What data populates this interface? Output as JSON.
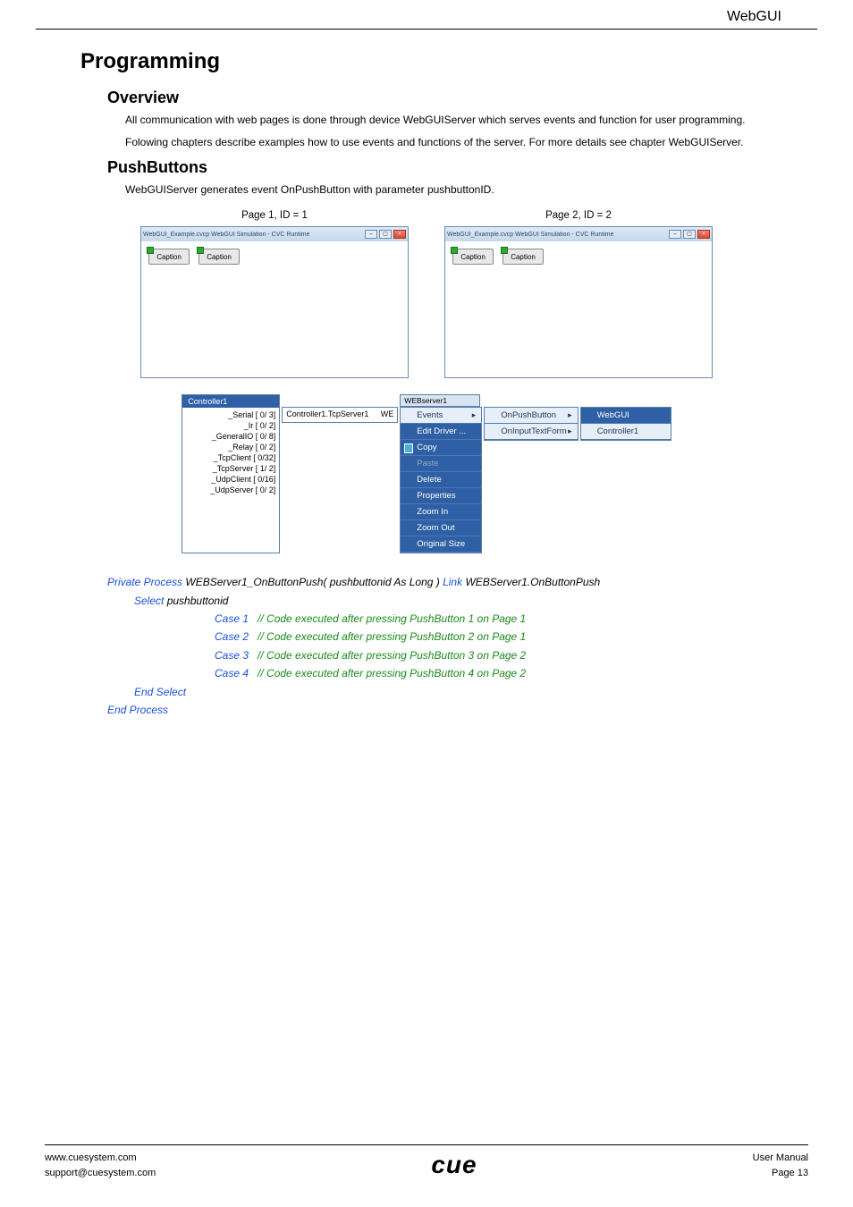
{
  "header": {
    "title": "WebGUI"
  },
  "h1": "Programming",
  "overview": {
    "title": "Overview",
    "p1": "All communication with web pages is done through device WebGUIServer which serves events and function for user programming.",
    "p2": "Folowing chapters describe examples how to use events and functions of the server. For more details see chapter WebGUIServer."
  },
  "push": {
    "title": "PushButtons",
    "p1": "WebGUIServer generates event OnPushButton with parameter pushbuttonID.",
    "page1_label": "Page 1, ID = 1",
    "page2_label": "Page 2, ID = 2",
    "window_title": "WebGUI_Example.cvcp WebGUI Simulation - CVC Runtime",
    "caption": "Caption"
  },
  "diagram": {
    "controller_title": "Controller1",
    "tree": [
      "_Serial [ 0/ 3]",
      "_Ir [ 0/ 2]",
      "_GeneralIO [ 0/ 8]",
      "_Relay [ 0/ 2]",
      "_TcpClient [ 0/32]",
      "_TcpServer [ 1/ 2]",
      "_UdpClient [ 0/16]",
      "_UdpServer [ 0/ 2]"
    ],
    "tcp_label": "Controller1.TcpServer1",
    "tcp_sub": "WE",
    "wb_title": "WEBserver1",
    "ctx": {
      "events": "Events",
      "edit": "Edit Driver ...",
      "copy": "Copy",
      "paste": "Paste",
      "delete": "Delete",
      "props": "Properties",
      "zoomin": "Zoom In",
      "zoomout": "Zoom Out",
      "orig": "Original Size"
    },
    "events_sub": {
      "onpush": "OnPushButton",
      "oninput": "OnInputTextForm"
    },
    "target_sub": {
      "webgui": "WebGUI",
      "ctrl": "Controller1"
    }
  },
  "code": {
    "l1a": "Private Process",
    "l1b": " WEBServer1_OnButtonPush( pushbuttonid As Long ) ",
    "l1c": "Link",
    "l1d": " WEBServer1.OnButtonPush",
    "l2a": "Select",
    "l2b": " pushbuttonid",
    "c1a": "Case 1",
    "c1b": "   // Code executed after pressing PushButton 1 on Page 1",
    "c2a": "Case 2",
    "c2b": "   // Code executed after pressing PushButton 2 on Page 1",
    "c3a": "Case 3",
    "c3b": "   // Code executed after pressing PushButton 3 on Page 2",
    "c4a": "Case 4",
    "c4b": "   // Code executed after pressing PushButton 4 on Page 2",
    "l3": "End Select",
    "l4": "End Process"
  },
  "footer": {
    "url": "www.cuesystem.com",
    "email": "support@cuesystem.com",
    "logo": "cue",
    "manual": "User Manual",
    "page": "Page 13"
  }
}
